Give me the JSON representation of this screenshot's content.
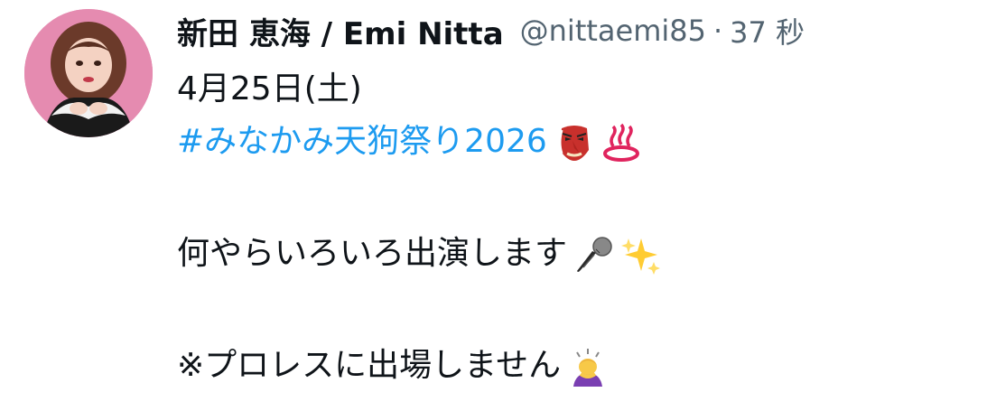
{
  "tweet": {
    "display_name": "新田 恵海 / Emi Nitta",
    "handle": "@nittaemi85",
    "separator": "·",
    "timestamp": "37 秒",
    "lines": {
      "date": "4月25日(土)",
      "hashtag": "#みなかみ天狗祭り2026",
      "announcement": "何やらいろいろ出演します",
      "note": "※プロレスに出場しません"
    },
    "emojis": {
      "tengu": "tengu-mask-icon",
      "hot_springs": "hot-springs-icon",
      "microphone": "microphone-icon",
      "sparkles": "sparkles-icon",
      "bowing": "person-bowing-icon"
    },
    "colors": {
      "hashtag": "#1d9bf0",
      "secondary_text": "#536471",
      "primary_text": "#0f1419",
      "background": "#ffffff"
    }
  }
}
